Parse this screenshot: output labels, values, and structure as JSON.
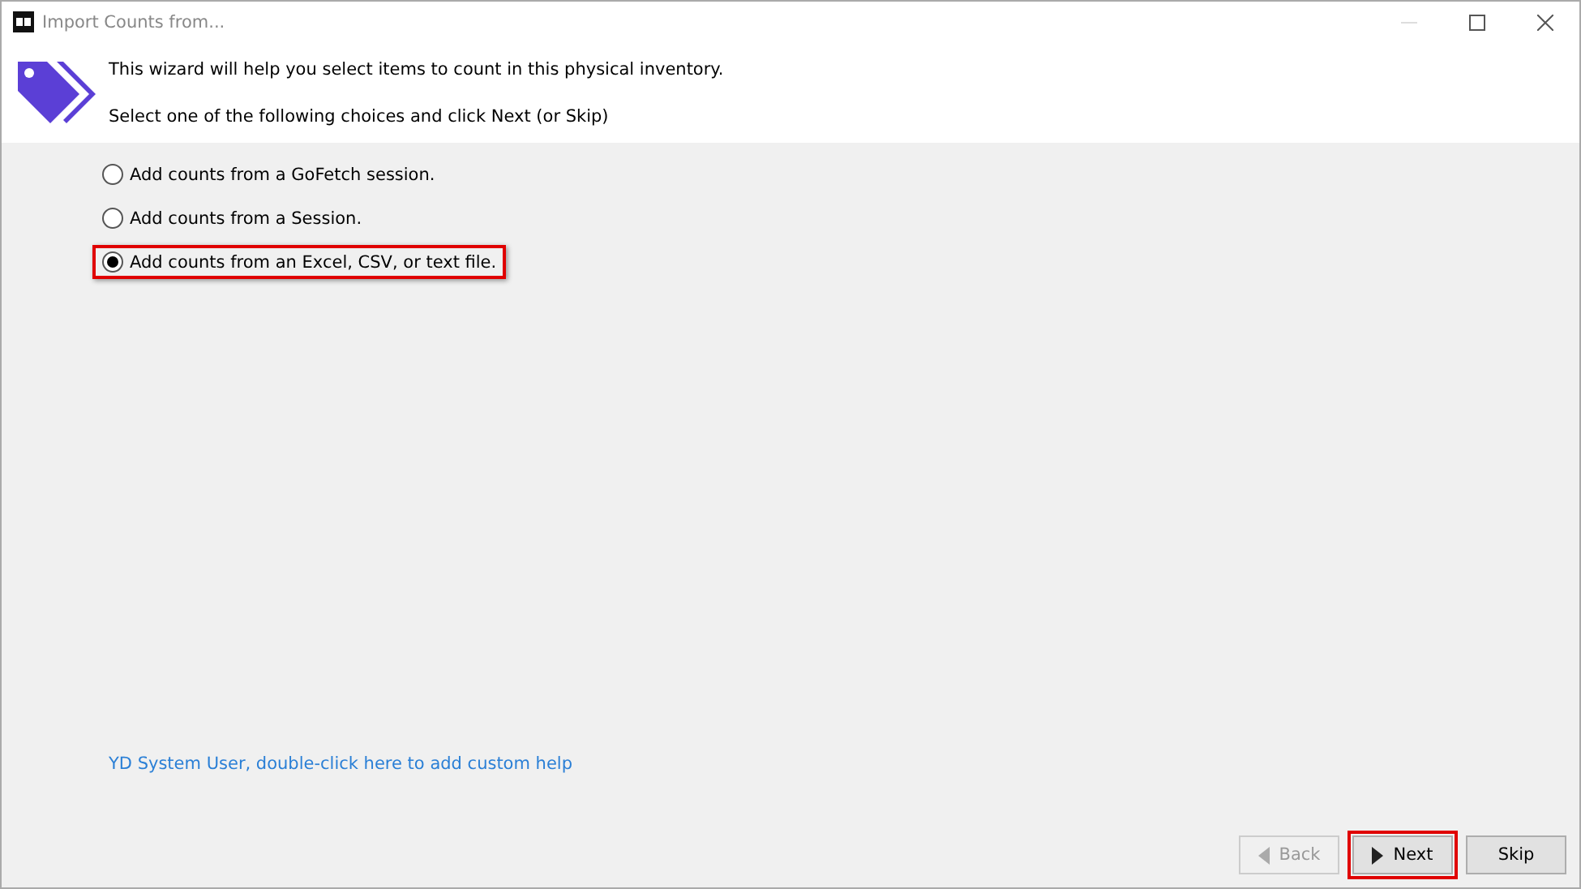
{
  "window": {
    "title": "Import Counts from..."
  },
  "header": {
    "intro": "This wizard will help you select items to count in this physical inventory.",
    "instruction": "Select one of the following choices and click Next (or Skip)"
  },
  "choices": [
    {
      "label": "Add counts from a GoFetch session.",
      "selected": false,
      "highlighted": false
    },
    {
      "label": "Add counts from a Session.",
      "selected": false,
      "highlighted": false
    },
    {
      "label": "Add counts from an Excel, CSV, or text file.",
      "selected": true,
      "highlighted": true
    }
  ],
  "help_link": "YD System User, double-click here to add custom help",
  "buttons": [
    {
      "kind": "back",
      "label": "Back",
      "disabled": true,
      "highlighted": false
    },
    {
      "kind": "next",
      "label": "Next",
      "disabled": false,
      "highlighted": true
    },
    {
      "kind": "skip",
      "label": "Skip",
      "disabled": false,
      "highlighted": false
    }
  ]
}
